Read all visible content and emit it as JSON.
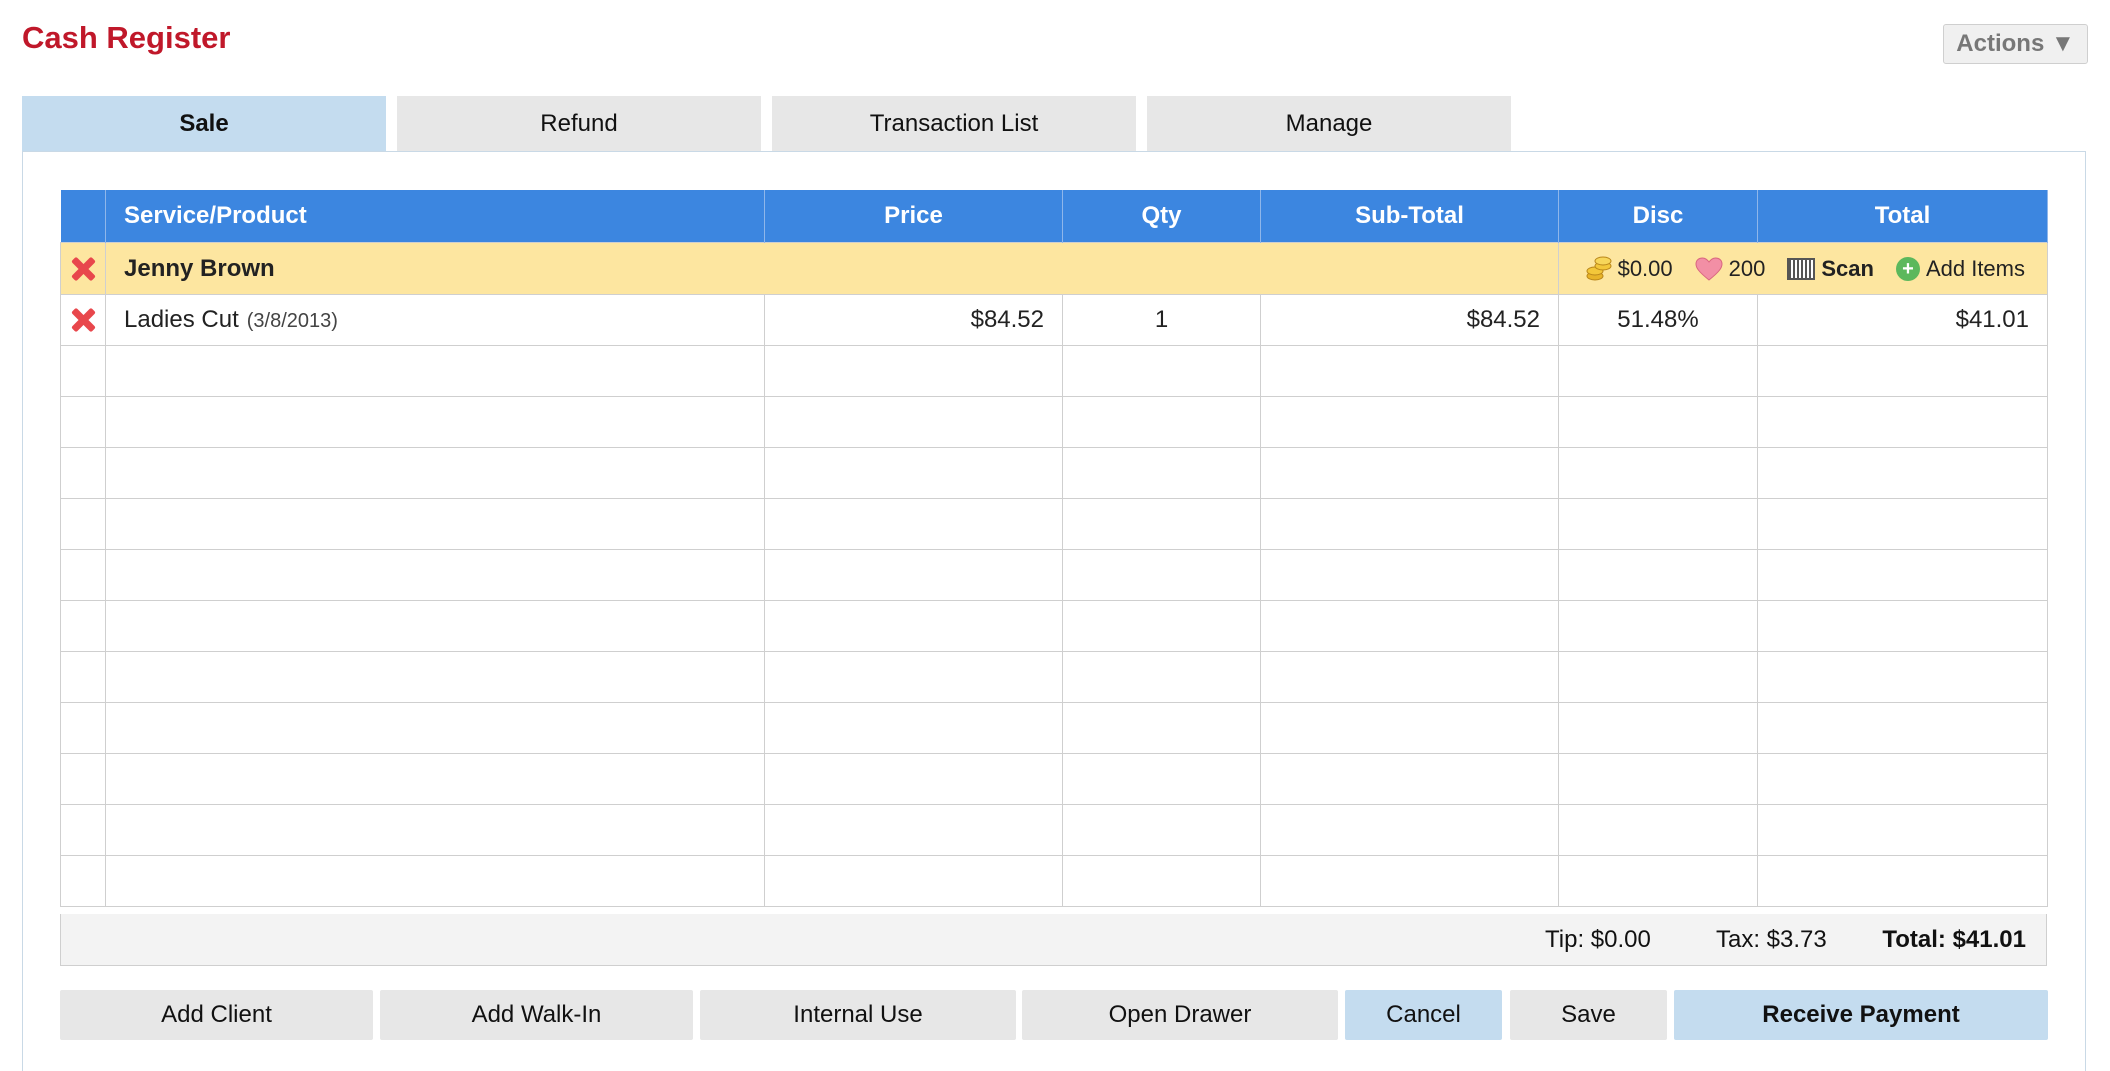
{
  "header": {
    "title": "Cash Register",
    "actions_label": "Actions ▼"
  },
  "tabs": [
    {
      "label": "Sale",
      "active": true
    },
    {
      "label": "Refund",
      "active": false
    },
    {
      "label": "Transaction List",
      "active": false
    },
    {
      "label": "Manage",
      "active": false
    }
  ],
  "table": {
    "columns": [
      "Service/Product",
      "Price",
      "Qty",
      "Sub-Total",
      "Disc",
      "Total"
    ],
    "client": {
      "name": "Jenny Brown",
      "balance": "$0.00",
      "points": "200",
      "scan_label": "Scan",
      "add_items_label": "Add Items"
    },
    "items": [
      {
        "name": "Ladies Cut",
        "date": "(3/8/2013)",
        "price": "$84.52",
        "qty": "1",
        "subtotal": "$84.52",
        "disc": "51.48%",
        "total": "$41.01"
      }
    ]
  },
  "summary": {
    "tip": "Tip: $0.00",
    "tax": "Tax: $3.73",
    "total": "Total: $41.01"
  },
  "buttons": {
    "add_client": "Add Client",
    "add_walkin": "Add Walk-In",
    "internal_use": "Internal Use",
    "open_drawer": "Open Drawer",
    "cancel": "Cancel",
    "save": "Save",
    "receive_payment": "Receive Payment"
  },
  "colors": {
    "title": "#c0182a",
    "header_blue": "#3c86e0",
    "active_tab": "#c4dcef",
    "client_row": "#fde6a0"
  }
}
